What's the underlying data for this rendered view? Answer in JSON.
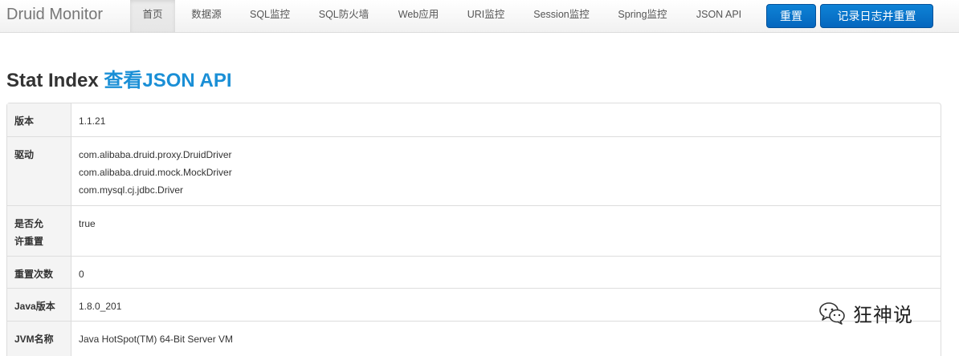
{
  "navbar": {
    "brand": "Druid Monitor",
    "items": [
      {
        "label": "首页",
        "active": true
      },
      {
        "label": "数据源"
      },
      {
        "label": "SQL监控"
      },
      {
        "label": "SQL防火墙"
      },
      {
        "label": "Web应用"
      },
      {
        "label": "URI监控"
      },
      {
        "label": "Session监控"
      },
      {
        "label": "Spring监控"
      },
      {
        "label": "JSON API"
      }
    ],
    "reset_button": "重置",
    "log_reset_button": "记录日志并重置"
  },
  "page": {
    "title": "Stat Index",
    "json_link": "查看JSON API"
  },
  "stats": [
    {
      "key": "版本",
      "value": [
        "1.1.21"
      ]
    },
    {
      "key": "驱动",
      "value": [
        "com.alibaba.druid.proxy.DruidDriver",
        "com.alibaba.druid.mock.MockDriver",
        "com.mysql.cj.jdbc.Driver"
      ]
    },
    {
      "key": "是否允许重置",
      "value": [
        "true"
      ]
    },
    {
      "key": "重置次数",
      "value": [
        "0"
      ]
    },
    {
      "key": "Java版本",
      "value": [
        "1.8.0_201"
      ]
    },
    {
      "key": "JVM名称",
      "value": [
        "Java HotSpot(TM) 64-Bit Server VM"
      ]
    }
  ],
  "watermark": {
    "text": "狂神说",
    "icon": "wechat-icon"
  },
  "colors": {
    "primary_button": "#0566be",
    "link": "#1a8fd6",
    "key_cell_bg": "#f4f4f4"
  }
}
